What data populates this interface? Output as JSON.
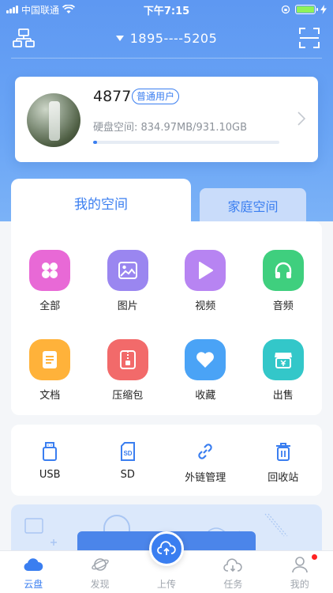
{
  "status_bar": {
    "carrier": "中国联通",
    "time": "下午7:15"
  },
  "header": {
    "account": "1895----5205",
    "left_icon": "layout-icon",
    "right_icon": "scan-icon"
  },
  "user_card": {
    "name": "4877",
    "badge": "普通用户",
    "storage_label": "硬盘空间: 834.97MB/931.10GB",
    "storage_fraction": 0.009
  },
  "space_tabs": {
    "active": "我的空间",
    "inactive": "家庭空间"
  },
  "categories": [
    {
      "label": "全部",
      "icon": "apps-icon",
      "color": "#e869d6"
    },
    {
      "label": "图片",
      "icon": "image-icon",
      "color": "#9a86f0"
    },
    {
      "label": "视频",
      "icon": "play-icon",
      "color": "#b784f2"
    },
    {
      "label": "音频",
      "icon": "headphones-icon",
      "color": "#3fcf7e"
    },
    {
      "label": "文档",
      "icon": "document-icon",
      "color": "#ffb23a"
    },
    {
      "label": "压缩包",
      "icon": "zip-icon",
      "color": "#f26a6a"
    },
    {
      "label": "收藏",
      "icon": "heart-icon",
      "color": "#4aa3f6"
    },
    {
      "label": "出售",
      "icon": "store-icon",
      "color": "#33c7c9"
    }
  ],
  "tools": [
    {
      "label": "USB",
      "icon": "usb-icon"
    },
    {
      "label": "SD",
      "icon": "sd-card-icon"
    },
    {
      "label": "外链管理",
      "icon": "link-icon"
    },
    {
      "label": "回收站",
      "icon": "trash-icon"
    }
  ],
  "tabbar": [
    {
      "label": "云盘",
      "icon": "cloud-icon",
      "active": true
    },
    {
      "label": "发现",
      "icon": "planet-icon",
      "active": false
    },
    {
      "label": "上传",
      "icon": "upload-icon",
      "active": false
    },
    {
      "label": "任务",
      "icon": "task-icon",
      "active": false
    },
    {
      "label": "我的",
      "icon": "user-icon",
      "active": false
    }
  ],
  "colors": {
    "accent": "#3a7ef0",
    "hero": "#5e98f2"
  }
}
